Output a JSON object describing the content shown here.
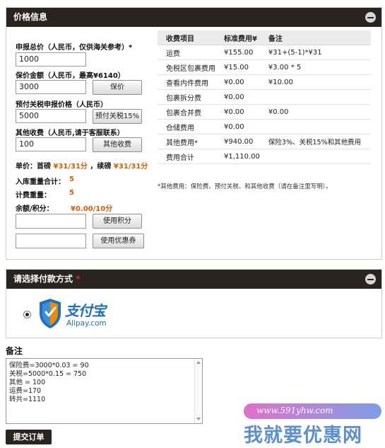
{
  "price_panel": {
    "title": "价格信息",
    "declared_total_label": "申报总价（人民币，仅供海关参考）*",
    "declared_total_value": "1000",
    "insured_label": "保价金额（人民币，最高¥6140）",
    "insured_value": "3000",
    "insure_button": "保价",
    "prepay_label": "预付关税申报价格（人民币）",
    "prepay_value": "5000",
    "prepay_button": "预付关税15%",
    "other_label": "其他收费（人民币,请于客服联系）",
    "other_value": "100",
    "other_button": "其他收费",
    "unit_price_label": "单价：首磅",
    "unit_price_first": "¥31/31分",
    "unit_price_sep": "，续磅",
    "unit_price_next": "¥31/31分",
    "inbound_weight_label": "入库重量合计：",
    "inbound_weight_value": "5",
    "billing_weight_label": "计费重量：",
    "billing_weight_value": "5",
    "balance_label": "余额/积分：",
    "balance_value": "¥0.00/10分",
    "points_button": "使用积分",
    "coupon_button": "使用优惠券",
    "fee_table": {
      "headers": [
        "收费项目",
        "标准费用¥",
        "备注"
      ],
      "rows": [
        [
          "运费",
          "¥155.00",
          "¥31+(5-1)*¥31"
        ],
        [
          "免税区包裹费用",
          "¥15.00",
          "¥3.00 * 5"
        ],
        [
          "查看内件费用",
          "¥0.00",
          "¥10.00"
        ],
        [
          "包裹拆分费",
          "¥0.00",
          ""
        ],
        [
          "包裹合并费",
          "¥0.00",
          "¥0.00"
        ],
        [
          "仓储费用",
          "¥0.00",
          ""
        ],
        [
          "其他费用*",
          "¥940.00",
          "保险3%、关税15%和其他费用"
        ],
        [
          "费用合计",
          "¥1,110.00",
          ""
        ]
      ]
    },
    "footnote": "*其他费用：保险费、预付关税、和其他收费（请在备注里写明）。"
  },
  "payment_panel": {
    "title": "请选择付款方式",
    "required_mark": "*",
    "alipay_text": "支付宝",
    "alipay_url": "Alipay.com",
    "alipay_selected": true
  },
  "remarks": {
    "title": "备注",
    "text": "保险费=3000*0.03 = 90\n关税=5000*0.15 = 750\n其他 = 100\n运费=170\n转共=1110",
    "submit_button": "提交订单"
  },
  "watermark": {
    "url": "www.591yhw.com",
    "text": "我就要优惠网"
  },
  "colors": {
    "header_bg": "#2a2420",
    "accent_red": "#e05a00",
    "alipay_blue": "#1e70c0",
    "alipay_orange": "#f08a00",
    "watermark_blue": "#5b8fd0",
    "watermark_pink": "#e070c8"
  }
}
